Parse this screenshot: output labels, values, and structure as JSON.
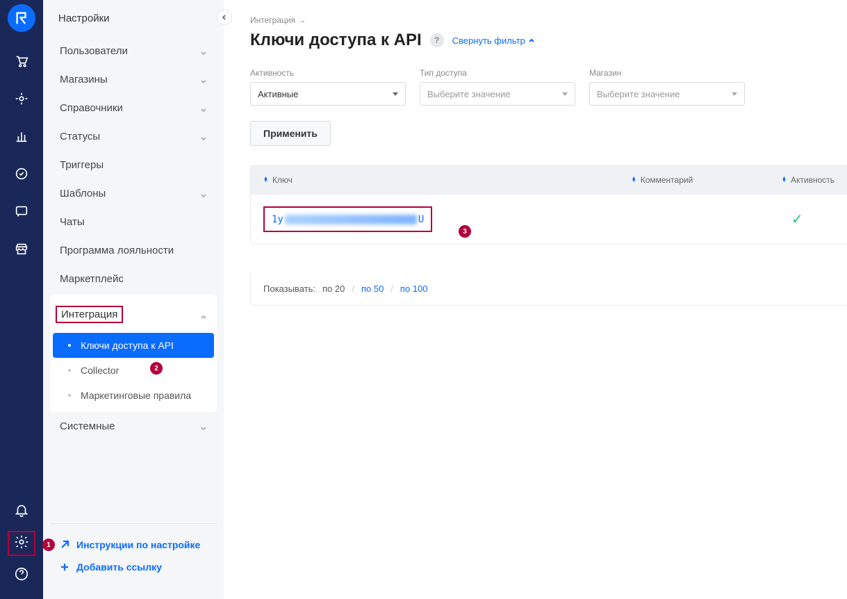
{
  "sidebar": {
    "title": "Настройки",
    "groups": [
      {
        "label": "Пользователи",
        "expandable": true
      },
      {
        "label": "Магазины",
        "expandable": true
      },
      {
        "label": "Справочники",
        "expandable": true
      },
      {
        "label": "Статусы",
        "expandable": true
      },
      {
        "label": "Триггеры",
        "expandable": false
      },
      {
        "label": "Шаблоны",
        "expandable": true
      },
      {
        "label": "Чаты",
        "expandable": false
      },
      {
        "label": "Программа лояльности",
        "expandable": false
      },
      {
        "label": "Маркетплейс",
        "expandable": false
      },
      {
        "label": "Интеграция",
        "expandable": true,
        "active": true,
        "children": [
          {
            "label": "Ключи доступа к API",
            "active": true
          },
          {
            "label": "Collector"
          },
          {
            "label": "Маркетинговые правила"
          }
        ]
      },
      {
        "label": "Системные",
        "expandable": true
      }
    ],
    "footer": {
      "instructions": "Инструкции по настройке",
      "add_link": "Добавить ссылку"
    }
  },
  "breadcrumb": "Интеграция →",
  "page_title": "Ключи доступа к API",
  "help_symbol": "?",
  "collapse_filter": "Свернуть фильтр",
  "filters": {
    "activity": {
      "label": "Активность",
      "value": "Активные"
    },
    "access_type": {
      "label": "Тип доступа",
      "placeholder": "Выберите значение"
    },
    "shop": {
      "label": "Магазин",
      "placeholder": "Выберите значение"
    }
  },
  "apply_label": "Применить",
  "table": {
    "headers": {
      "key": "Ключ",
      "comment": "Комментарий",
      "active": "Активность"
    },
    "row": {
      "key_prefix": "1y",
      "key_suffix": "U",
      "active": true
    }
  },
  "pagination": {
    "label": "Показывать:",
    "p20": "по 20",
    "p50": "по 50",
    "p100": "по 100"
  },
  "annotations": {
    "b1": "1",
    "b2": "2",
    "b3": "3"
  }
}
